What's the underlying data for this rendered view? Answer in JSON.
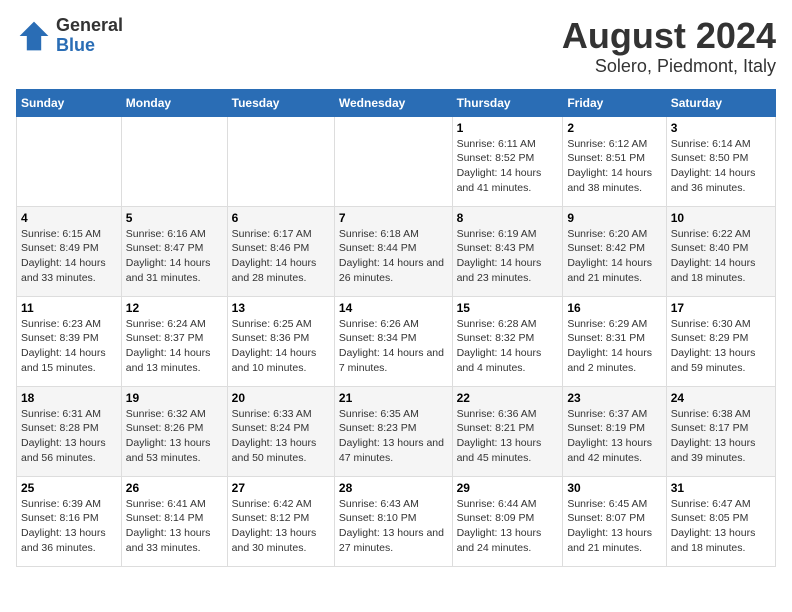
{
  "logo": {
    "general": "General",
    "blue": "Blue"
  },
  "title": "August 2024",
  "subtitle": "Solero, Piedmont, Italy",
  "days_of_week": [
    "Sunday",
    "Monday",
    "Tuesday",
    "Wednesday",
    "Thursday",
    "Friday",
    "Saturday"
  ],
  "weeks": [
    [
      {
        "day": "",
        "info": ""
      },
      {
        "day": "",
        "info": ""
      },
      {
        "day": "",
        "info": ""
      },
      {
        "day": "",
        "info": ""
      },
      {
        "day": "1",
        "info": "Sunrise: 6:11 AM\nSunset: 8:52 PM\nDaylight: 14 hours and 41 minutes."
      },
      {
        "day": "2",
        "info": "Sunrise: 6:12 AM\nSunset: 8:51 PM\nDaylight: 14 hours and 38 minutes."
      },
      {
        "day": "3",
        "info": "Sunrise: 6:14 AM\nSunset: 8:50 PM\nDaylight: 14 hours and 36 minutes."
      }
    ],
    [
      {
        "day": "4",
        "info": "Sunrise: 6:15 AM\nSunset: 8:49 PM\nDaylight: 14 hours and 33 minutes."
      },
      {
        "day": "5",
        "info": "Sunrise: 6:16 AM\nSunset: 8:47 PM\nDaylight: 14 hours and 31 minutes."
      },
      {
        "day": "6",
        "info": "Sunrise: 6:17 AM\nSunset: 8:46 PM\nDaylight: 14 hours and 28 minutes."
      },
      {
        "day": "7",
        "info": "Sunrise: 6:18 AM\nSunset: 8:44 PM\nDaylight: 14 hours and 26 minutes."
      },
      {
        "day": "8",
        "info": "Sunrise: 6:19 AM\nSunset: 8:43 PM\nDaylight: 14 hours and 23 minutes."
      },
      {
        "day": "9",
        "info": "Sunrise: 6:20 AM\nSunset: 8:42 PM\nDaylight: 14 hours and 21 minutes."
      },
      {
        "day": "10",
        "info": "Sunrise: 6:22 AM\nSunset: 8:40 PM\nDaylight: 14 hours and 18 minutes."
      }
    ],
    [
      {
        "day": "11",
        "info": "Sunrise: 6:23 AM\nSunset: 8:39 PM\nDaylight: 14 hours and 15 minutes."
      },
      {
        "day": "12",
        "info": "Sunrise: 6:24 AM\nSunset: 8:37 PM\nDaylight: 14 hours and 13 minutes."
      },
      {
        "day": "13",
        "info": "Sunrise: 6:25 AM\nSunset: 8:36 PM\nDaylight: 14 hours and 10 minutes."
      },
      {
        "day": "14",
        "info": "Sunrise: 6:26 AM\nSunset: 8:34 PM\nDaylight: 14 hours and 7 minutes."
      },
      {
        "day": "15",
        "info": "Sunrise: 6:28 AM\nSunset: 8:32 PM\nDaylight: 14 hours and 4 minutes."
      },
      {
        "day": "16",
        "info": "Sunrise: 6:29 AM\nSunset: 8:31 PM\nDaylight: 14 hours and 2 minutes."
      },
      {
        "day": "17",
        "info": "Sunrise: 6:30 AM\nSunset: 8:29 PM\nDaylight: 13 hours and 59 minutes."
      }
    ],
    [
      {
        "day": "18",
        "info": "Sunrise: 6:31 AM\nSunset: 8:28 PM\nDaylight: 13 hours and 56 minutes."
      },
      {
        "day": "19",
        "info": "Sunrise: 6:32 AM\nSunset: 8:26 PM\nDaylight: 13 hours and 53 minutes."
      },
      {
        "day": "20",
        "info": "Sunrise: 6:33 AM\nSunset: 8:24 PM\nDaylight: 13 hours and 50 minutes."
      },
      {
        "day": "21",
        "info": "Sunrise: 6:35 AM\nSunset: 8:23 PM\nDaylight: 13 hours and 47 minutes."
      },
      {
        "day": "22",
        "info": "Sunrise: 6:36 AM\nSunset: 8:21 PM\nDaylight: 13 hours and 45 minutes."
      },
      {
        "day": "23",
        "info": "Sunrise: 6:37 AM\nSunset: 8:19 PM\nDaylight: 13 hours and 42 minutes."
      },
      {
        "day": "24",
        "info": "Sunrise: 6:38 AM\nSunset: 8:17 PM\nDaylight: 13 hours and 39 minutes."
      }
    ],
    [
      {
        "day": "25",
        "info": "Sunrise: 6:39 AM\nSunset: 8:16 PM\nDaylight: 13 hours and 36 minutes."
      },
      {
        "day": "26",
        "info": "Sunrise: 6:41 AM\nSunset: 8:14 PM\nDaylight: 13 hours and 33 minutes."
      },
      {
        "day": "27",
        "info": "Sunrise: 6:42 AM\nSunset: 8:12 PM\nDaylight: 13 hours and 30 minutes."
      },
      {
        "day": "28",
        "info": "Sunrise: 6:43 AM\nSunset: 8:10 PM\nDaylight: 13 hours and 27 minutes."
      },
      {
        "day": "29",
        "info": "Sunrise: 6:44 AM\nSunset: 8:09 PM\nDaylight: 13 hours and 24 minutes."
      },
      {
        "day": "30",
        "info": "Sunrise: 6:45 AM\nSunset: 8:07 PM\nDaylight: 13 hours and 21 minutes."
      },
      {
        "day": "31",
        "info": "Sunrise: 6:47 AM\nSunset: 8:05 PM\nDaylight: 13 hours and 18 minutes."
      }
    ]
  ]
}
